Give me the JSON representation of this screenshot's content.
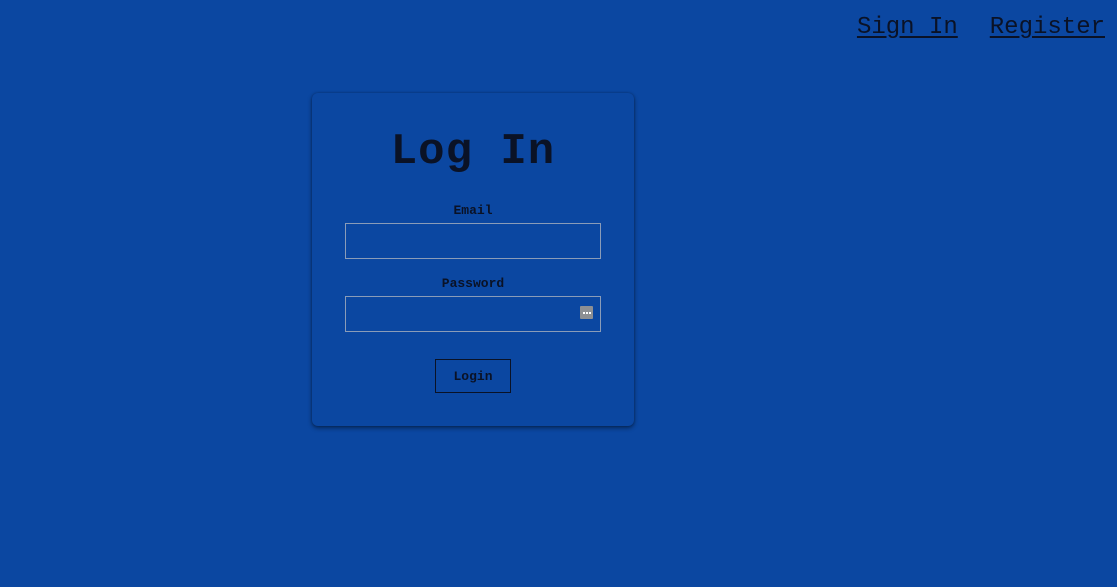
{
  "nav": {
    "sign_in": "Sign In",
    "register": "Register"
  },
  "login_form": {
    "title": "Log In",
    "email_label": "Email",
    "email_value": "",
    "password_label": "Password",
    "password_value": "",
    "password_manager_icon": "more-dots-icon",
    "submit_label": "Login"
  },
  "colors": {
    "background": "#0b47a1",
    "text": "#0a1226",
    "input_border": "#8a9cb8"
  }
}
